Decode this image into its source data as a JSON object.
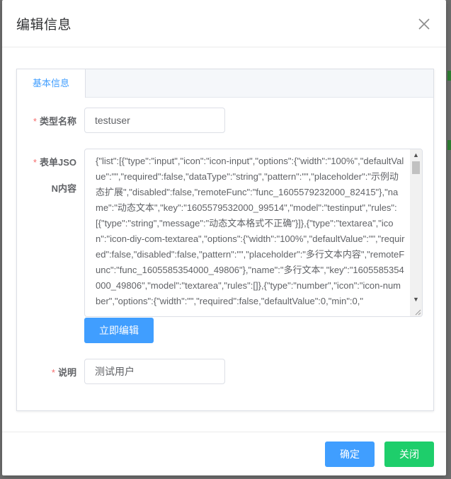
{
  "dialog": {
    "title": "编辑信息",
    "close_icon": "close-icon"
  },
  "tabs": [
    {
      "label": "基本信息",
      "active": true
    }
  ],
  "form": {
    "type_name": {
      "label": "类型名称",
      "value": "testuser"
    },
    "form_json": {
      "label_line1": "表单JSO",
      "label_line2": "N内容",
      "value": "{\"list\":[{\"type\":\"input\",\"icon\":\"icon-input\",\"options\":{\"width\":\"100%\",\"defaultValue\":\"\",\"required\":false,\"dataType\":\"string\",\"pattern\":\"\",\"placeholder\":\"示例动态扩展\",\"disabled\":false,\"remoteFunc\":\"func_1605579232000_82415\"},\"name\":\"动态文本\",\"key\":\"1605579532000_99514\",\"model\":\"testinput\",\"rules\":[{\"type\":\"string\",\"message\":\"动态文本格式不正确\"}]},{\"type\":\"textarea\",\"icon\":\"icon-diy-com-textarea\",\"options\":{\"width\":\"100%\",\"defaultValue\":\"\",\"required\":false,\"disabled\":false,\"pattern\":\"\",\"placeholder\":\"多行文本内容\",\"remoteFunc\":\"func_1605585354000_49806\"},\"name\":\"多行文本\",\"key\":\"1605585354000_49806\",\"model\":\"textarea\",\"rules\":[]},{\"type\":\"number\",\"icon\":\"icon-number\",\"options\":{\"width\":\"\",\"required\":false,\"defaultValue\":0,\"min\":0,\""
    },
    "edit_button": "立即编辑",
    "description": {
      "label": "说明",
      "value": "测试用户"
    }
  },
  "footer": {
    "confirm": "确定",
    "close": "关闭"
  },
  "colors": {
    "primary": "#409eff",
    "success": "#1ece6b",
    "required": "#f56c6c"
  }
}
